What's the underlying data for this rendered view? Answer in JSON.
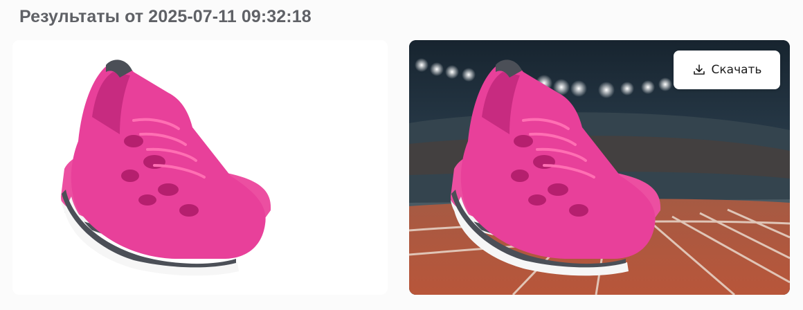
{
  "header": {
    "title": "Результаты от 2025-07-11 09:32:18"
  },
  "original_image": {
    "subject": "pink-running-shoes",
    "background": "#ffffff"
  },
  "result_image": {
    "subject": "pink-running-shoes",
    "background": "stadium-running-track"
  },
  "actions": {
    "download_label": "Скачать",
    "download_icon": "download-icon"
  },
  "colors": {
    "title": "#5f6166",
    "shoe_pink": "#e8409a",
    "shoe_dark": "#4b4f57",
    "track": "#b8563a"
  }
}
